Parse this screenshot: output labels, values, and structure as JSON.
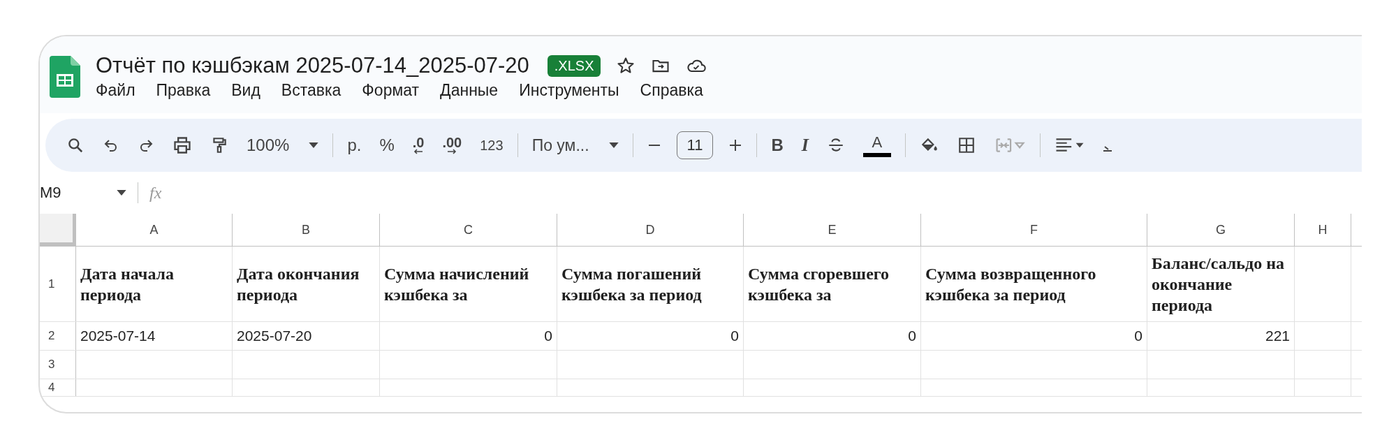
{
  "document": {
    "title": "Отчёт по кэшбэкам 2025-07-14_2025-07-20",
    "format_badge": ".XLSX"
  },
  "menu": [
    "Файл",
    "Правка",
    "Вид",
    "Вставка",
    "Формат",
    "Данные",
    "Инструменты",
    "Справка"
  ],
  "toolbar": {
    "zoom": "100%",
    "currency": "р.",
    "percent": "%",
    "decrease_decimals": ".0",
    "increase_decimals": ".00",
    "number_format": "123",
    "font": "По ум...",
    "font_size": "11",
    "bold": "B",
    "italic": "I",
    "text_color": "A",
    "merge_disabled": true
  },
  "formula_bar": {
    "cell_ref": "M9",
    "fx": "fx"
  },
  "sheet": {
    "columns": [
      "A",
      "B",
      "C",
      "D",
      "E",
      "F",
      "G",
      "H"
    ],
    "rows": [
      {
        "number": "1",
        "cells": [
          {
            "kind": "header",
            "text": "Дата начала периода"
          },
          {
            "kind": "header",
            "text": "Дата окончания периода"
          },
          {
            "kind": "header",
            "text": "Сумма начислений кэшбека за"
          },
          {
            "kind": "header",
            "text": "Сумма погашений кэшбека за период"
          },
          {
            "kind": "header",
            "text": "Сумма сгоревшего кэшбека за"
          },
          {
            "kind": "header",
            "text": "Сумма возвращенного кэшбека за период"
          },
          {
            "kind": "header",
            "text": "Баланс/сальдо на окончание периода"
          }
        ]
      },
      {
        "number": "2",
        "cells": [
          {
            "kind": "text",
            "text": "2025-07-14"
          },
          {
            "kind": "text",
            "text": "2025-07-20"
          },
          {
            "kind": "number",
            "text": "0"
          },
          {
            "kind": "number",
            "text": "0"
          },
          {
            "kind": "number",
            "text": "0"
          },
          {
            "kind": "number",
            "text": "0"
          },
          {
            "kind": "number",
            "text": "221"
          }
        ]
      },
      {
        "number": "3",
        "cells": []
      },
      {
        "number": "4",
        "cells": []
      }
    ]
  }
}
